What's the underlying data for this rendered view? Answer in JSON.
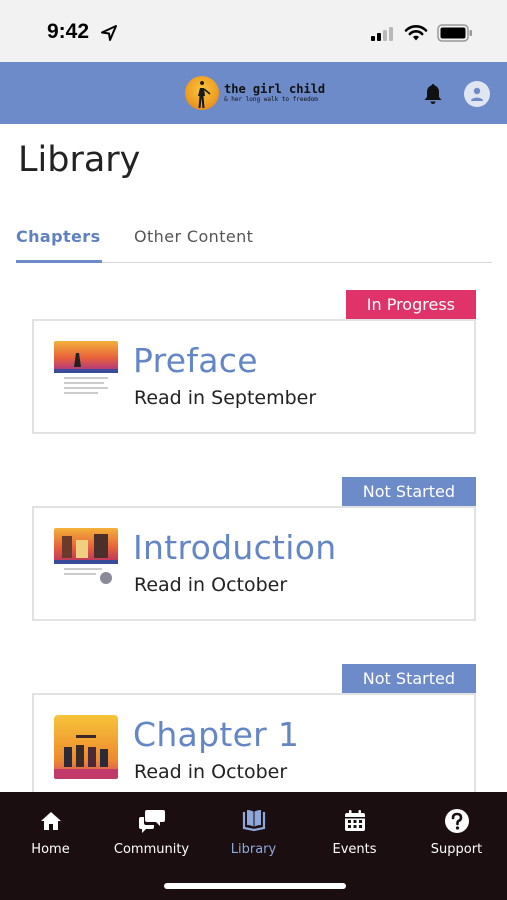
{
  "status_bar": {
    "time": "9:42"
  },
  "header": {
    "logo_title": "the girl child",
    "logo_tagline": "& her long walk to freedom"
  },
  "page": {
    "title": "Library"
  },
  "tabs": [
    {
      "label": "Chapters",
      "active": true
    },
    {
      "label": "Other Content",
      "active": false
    }
  ],
  "chapters": [
    {
      "title": "Preface",
      "subtitle": "Read in September",
      "status": "In Progress",
      "status_color": "#e0336a"
    },
    {
      "title": "Introduction",
      "subtitle": "Read in October",
      "status": "Not Started",
      "status_color": "#6c8bc8"
    },
    {
      "title": "Chapter 1",
      "subtitle": "Read in October",
      "status": "Not Started",
      "status_color": "#6c8bc8"
    }
  ],
  "nav": [
    {
      "label": "Home",
      "icon": "home-icon"
    },
    {
      "label": "Community",
      "icon": "chat-bubbles-icon"
    },
    {
      "label": "Library",
      "icon": "book-icon",
      "active": true
    },
    {
      "label": "Events",
      "icon": "calendar-icon"
    },
    {
      "label": "Support",
      "icon": "help-icon"
    }
  ],
  "colors": {
    "header": "#6c8bc8",
    "accent": "#6486c6",
    "in_progress": "#e0336a",
    "nav_bg": "#1a0e10"
  }
}
